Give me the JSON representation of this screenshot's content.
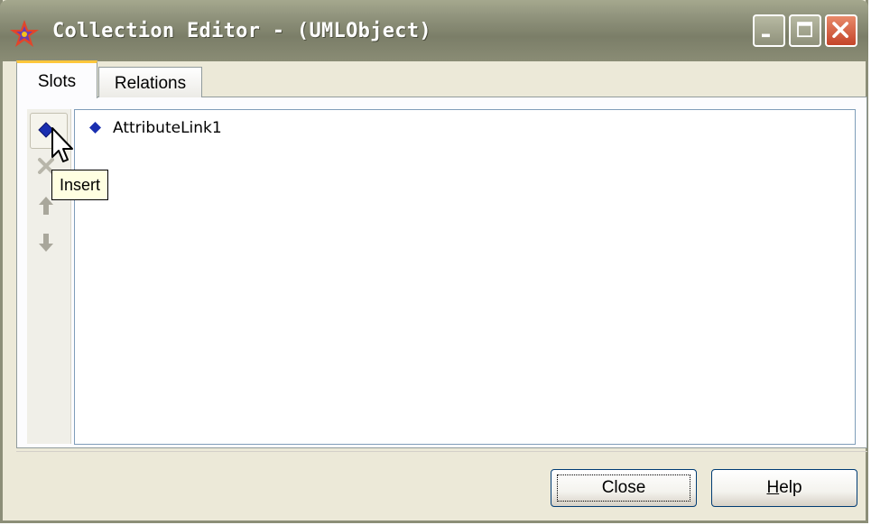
{
  "window": {
    "title": "Collection Editor - (UMLObject)",
    "app_icon": "star-icon",
    "controls": [
      "minimize-icon",
      "maximize-icon",
      "close-icon"
    ]
  },
  "tabs": [
    {
      "label": "Slots",
      "active": true
    },
    {
      "label": "Relations",
      "active": false
    }
  ],
  "toolbar": {
    "items": [
      {
        "icon": "insert-diamond-icon",
        "name": "Insert"
      },
      {
        "icon": "delete-x-icon",
        "name": "Delete"
      },
      {
        "icon": "arrow-up-icon",
        "name": "Move Up"
      },
      {
        "icon": "arrow-down-icon",
        "name": "Move Down"
      }
    ]
  },
  "list": {
    "items": [
      {
        "label": "AttributeLink1",
        "icon": "diamond-icon"
      }
    ]
  },
  "tooltip": {
    "text": "Insert"
  },
  "buttons": {
    "close": {
      "label": "Close"
    },
    "help": {
      "label_underlined": "H",
      "label_rest": "elp"
    }
  },
  "colors": {
    "titlebar": "#8e917a",
    "diamond": "#1a2fb0",
    "tab_highlight": "#ffc73c",
    "tooltip_bg": "#ffffe1"
  }
}
